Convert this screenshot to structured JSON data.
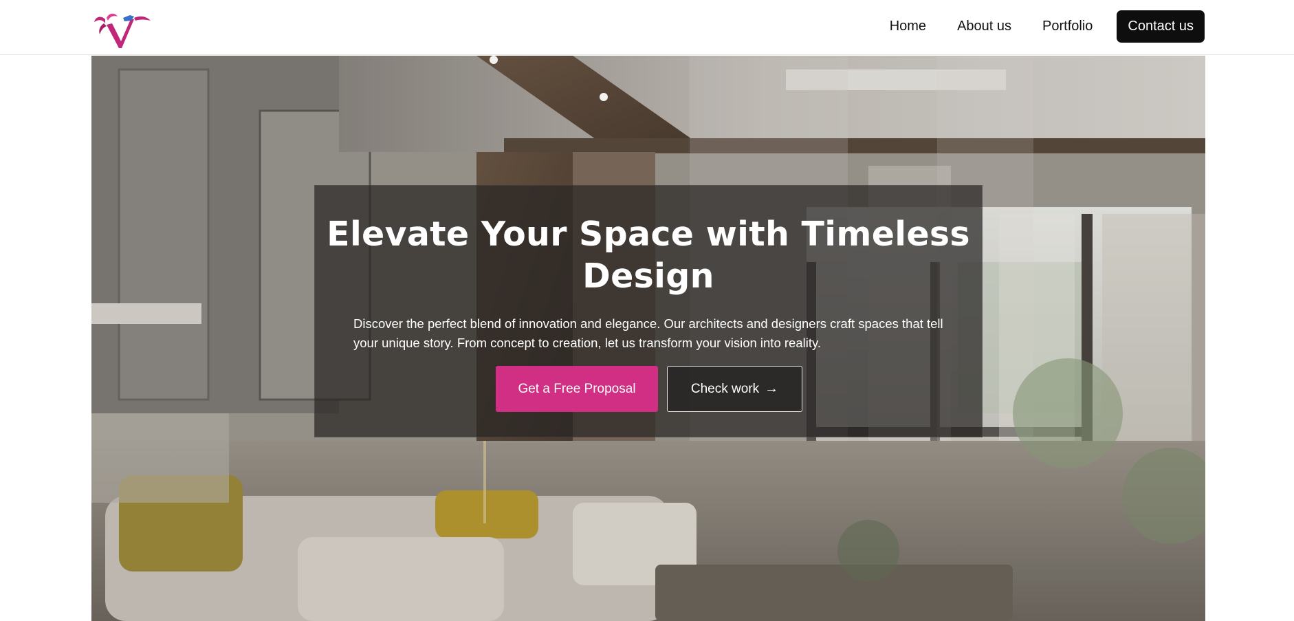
{
  "brand": {
    "logo_letter": "V",
    "logo_primary_color": "#c0267a",
    "logo_accent_color": "#3b6fc9"
  },
  "nav": {
    "links": [
      "Home",
      "About us",
      "Portfolio"
    ],
    "contact_label": "Contact us"
  },
  "hero": {
    "title": "Elevate Your Space with Timeless Design",
    "description": "Discover the perfect blend of innovation and elegance. Our architects and designers craft spaces that tell your unique story. From concept to creation, let us transform your vision into reality.",
    "primary_button": "Get a Free Proposal",
    "secondary_button": "Check work",
    "secondary_button_icon": "arrow-right-icon",
    "background_image": "interior-living-room-photo"
  },
  "colors": {
    "accent": "#d02f84",
    "nav_contact_bg": "#0e0e0e",
    "overlay": "rgba(40,38,36,0.72)"
  }
}
